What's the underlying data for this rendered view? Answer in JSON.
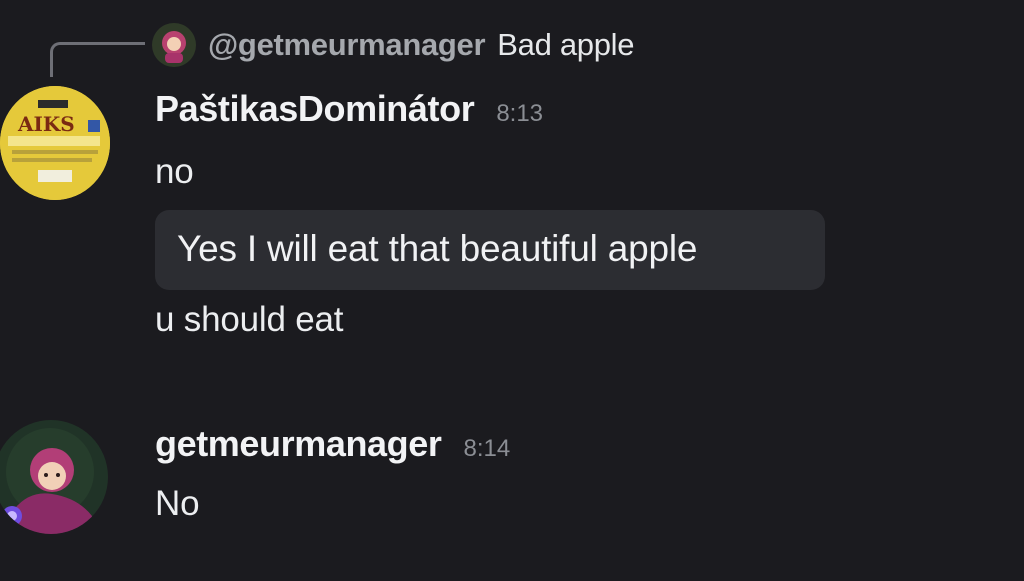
{
  "reply": {
    "author": "@getmeurmanager",
    "text": "Bad apple"
  },
  "messages": [
    {
      "username": "PaštikasDominátor",
      "timestamp": "8:13",
      "lines": [
        "no"
      ],
      "quote": "Yes I will eat that beautiful apple",
      "after_quote": "u should eat"
    },
    {
      "username": "getmeurmanager",
      "timestamp": "8:14",
      "lines": [
        "No"
      ]
    }
  ],
  "colors": {
    "background": "#1b1b1f",
    "username": "#f2f3f5",
    "timestamp": "#8b8e94",
    "bubble": "#2c2d32"
  },
  "icons": [
    "reply-avatar-icon",
    "avatar-pastikas",
    "avatar-getmeurmanager"
  ]
}
